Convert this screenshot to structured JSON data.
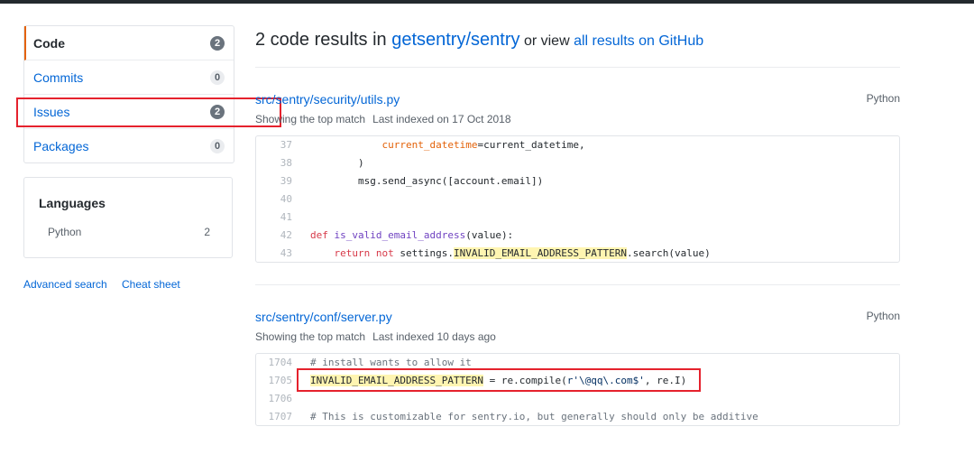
{
  "sidebar": {
    "menu": [
      {
        "label": "Code",
        "count": "2"
      },
      {
        "label": "Commits",
        "count": "0"
      },
      {
        "label": "Issues",
        "count": "2"
      },
      {
        "label": "Packages",
        "count": "0"
      }
    ],
    "languages": {
      "title": "Languages",
      "items": [
        {
          "name": "Python",
          "count": "2"
        }
      ]
    },
    "advanced_search": "Advanced search",
    "cheat_sheet": "Cheat sheet"
  },
  "header": {
    "count_text": "2 code results in ",
    "repo": "getsentry/sentry",
    "or_view": " or view ",
    "all_results": "all results on GitHub"
  },
  "results": [
    {
      "path": "src/sentry/security/utils.py",
      "language": "Python",
      "match_text": "Showing the top match",
      "indexed_text": "Last indexed on 17 Oct 2018",
      "lines": [
        {
          "num": "37",
          "indent": "            ",
          "arg": "current_datetime",
          "rest": "=current_datetime,"
        },
        {
          "num": "38",
          "text": "        )"
        },
        {
          "num": "39",
          "text": "        msg.send_async([account.email])"
        },
        {
          "num": "40",
          "text": ""
        },
        {
          "num": "41",
          "text": ""
        },
        {
          "num": "42",
          "kw": "def",
          "fn": "is_valid_email_address",
          "rest": "(value):"
        },
        {
          "num": "43",
          "indent": "    ",
          "kw1": "return",
          "kw2": "not",
          "pre": " settings.",
          "hl": "INVALID_EMAIL_ADDRESS_PATTERN",
          "post": ".search(value)"
        }
      ]
    },
    {
      "path": "src/sentry/conf/server.py",
      "language": "Python",
      "match_text": "Showing the top match",
      "indexed_text": "Last indexed 10 days ago",
      "lines": [
        {
          "num": "1704",
          "text": "# install wants to allow it"
        },
        {
          "num": "1705",
          "hl": "INVALID_EMAIL_ADDRESS_PATTERN",
          "mid": " = re.compile(",
          "str": "r'\\@qq\\.com$'",
          "post": ", re.I)"
        },
        {
          "num": "1706",
          "text": ""
        },
        {
          "num": "1707",
          "text": "# This is customizable for sentry.io, but generally should only be additive"
        }
      ]
    }
  ],
  "colors": {
    "annotation_red": "#e5222d",
    "link_blue": "#0366d6",
    "selected_accent": "#e36209"
  }
}
